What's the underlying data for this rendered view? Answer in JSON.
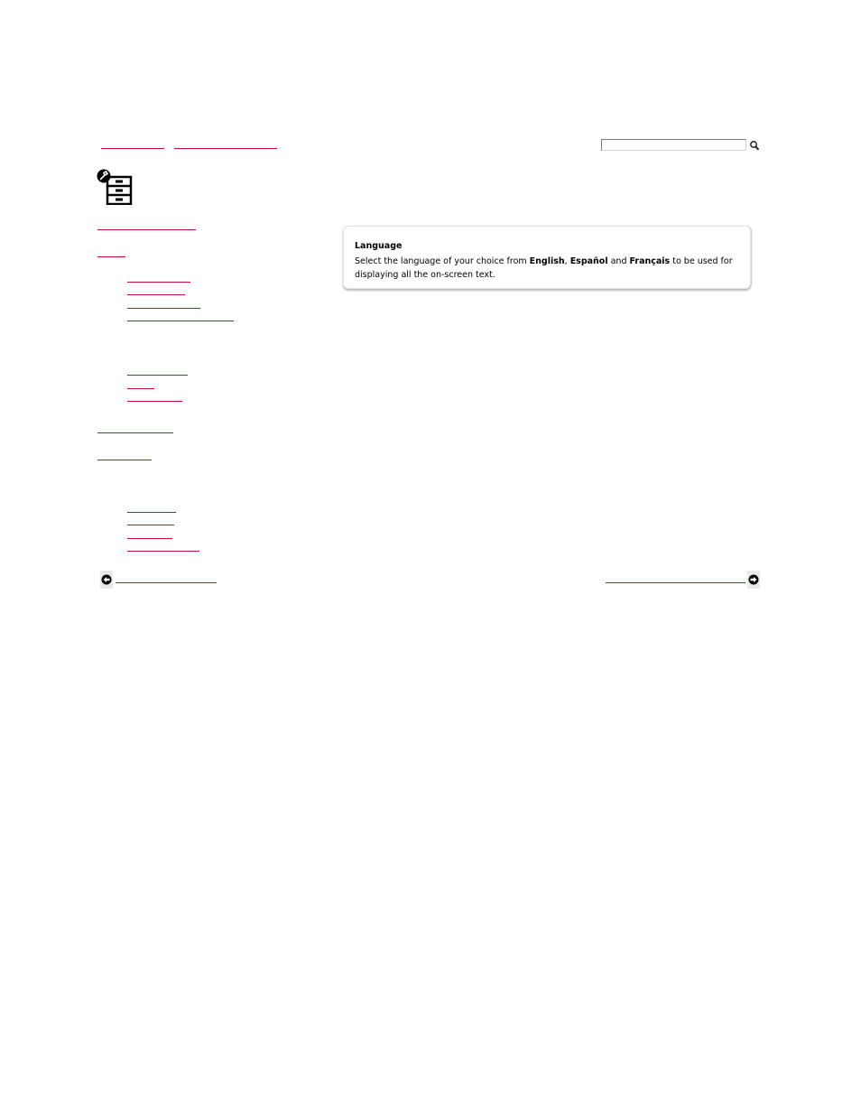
{
  "search": {
    "value": "",
    "placeholder": ""
  },
  "icons": {
    "page": "settings-drawer-icon",
    "search": "magnifier-icon",
    "prev": "arrow-left-icon",
    "next": "arrow-right-icon"
  },
  "callout": {
    "title": "Language",
    "body_prefix": "Select the language of your choice from ",
    "opt_english": "English",
    "sep_comma": ", ",
    "opt_espanol": "Español",
    "sep_and": " and ",
    "opt_francais": "Français",
    "body_suffix": " to be used for displaying all the on-screen text."
  },
  "colors": {
    "link_red": "#c8102e",
    "nav_button_bg": "#e9e9e9"
  }
}
